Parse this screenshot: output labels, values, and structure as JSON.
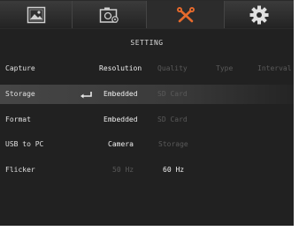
{
  "header": {
    "tabs": [
      {
        "icon": "image-icon"
      },
      {
        "icon": "camera-settings-icon"
      },
      {
        "icon": "tools-icon",
        "active": true,
        "accent": "#e66a2c"
      },
      {
        "icon": "gear-icon"
      }
    ]
  },
  "menu": {
    "title": "SETTING",
    "rows": [
      {
        "label": "Capture",
        "options": [
          "Resolution",
          "Quality",
          "Type",
          "Interval"
        ]
      },
      {
        "label": "Storage",
        "options": [
          "Embedded",
          "SD Card"
        ],
        "selected": true
      },
      {
        "label": "Format",
        "options": [
          "Embedded",
          "SD Card"
        ]
      },
      {
        "label": "USB to PC",
        "options": [
          "Camera",
          "Storage"
        ]
      },
      {
        "label": "Flicker",
        "options": [
          "50 Hz",
          "60 Hz"
        ]
      }
    ]
  },
  "colors": {
    "background": "#212121",
    "active_text": "#f0f0f0",
    "dim_text": "#5a5a5a",
    "accent": "#e66a2c"
  }
}
